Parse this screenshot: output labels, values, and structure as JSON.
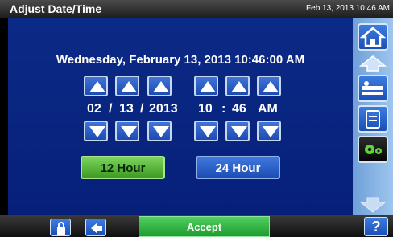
{
  "header": {
    "title": "Adjust Date/Time",
    "clock": "Feb 13, 2013 10:46 AM"
  },
  "main": {
    "date_line": "Wednesday, February 13, 2013 10:46:00 AM",
    "month": "02",
    "sep1": "/",
    "day": "13",
    "sep2": "/",
    "year": "2013",
    "hour": "10",
    "colon": ":",
    "minute": "46",
    "ampm": "AM",
    "btn_12": "12 Hour",
    "btn_24": "24 Hour"
  },
  "footer": {
    "accept_label": "Accept",
    "help_label": "?"
  },
  "icons": {
    "sidebar": [
      "home-icon",
      "scroll-up-icon",
      "bed-icon",
      "document-icon",
      "gears-icon",
      "scroll-down-icon"
    ],
    "bottom": [
      "lock-icon",
      "back-arrow-icon"
    ]
  },
  "colors": {
    "panel": "#06207a",
    "accent_green": "#3e9a22",
    "button_blue": "#1c4bb4",
    "sidebar": "#9ec5ee"
  }
}
